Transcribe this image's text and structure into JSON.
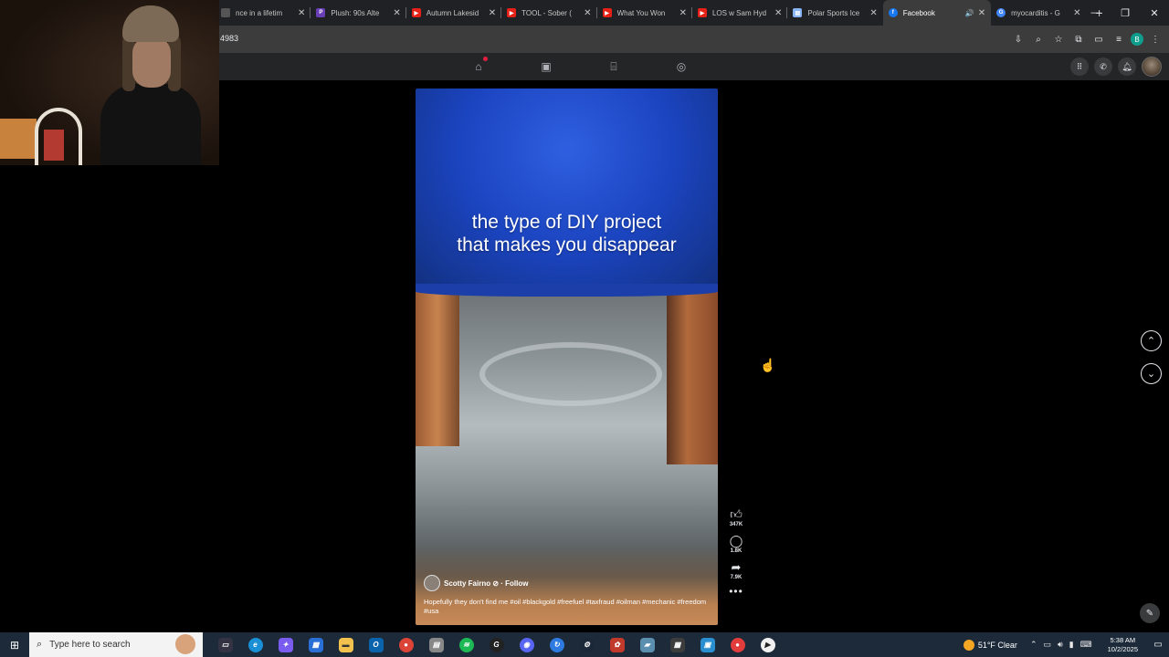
{
  "browser": {
    "tabs": [
      {
        "title": "nce in a lifetim",
        "fav_color": "#555555",
        "fav_glyph": ""
      },
      {
        "title": "Plush: 90s Alte",
        "fav_color": "#6a3fb5",
        "fav_glyph": "P"
      },
      {
        "title": "Autumn Lakesid",
        "fav_color": "#e62117",
        "fav_glyph": "▶"
      },
      {
        "title": "TOOL - Sober (",
        "fav_color": "#e62117",
        "fav_glyph": "▶"
      },
      {
        "title": "What You Won",
        "fav_color": "#e62117",
        "fav_glyph": "▶"
      },
      {
        "title": "LOS w Sam Hyd",
        "fav_color": "#e62117",
        "fav_glyph": "▶"
      },
      {
        "title": "Polar Sports Ice",
        "fav_color": "#8ab4f8",
        "fav_glyph": "▤"
      },
      {
        "title": "Facebook",
        "fav_color": "#1877f2",
        "fav_glyph": "f"
      },
      {
        "title": "myocarditis - G",
        "fav_color": "#4285f4",
        "fav_glyph": "G"
      }
    ],
    "active_tab_index": 7,
    "new_tab": "+",
    "address_text": "4983",
    "profile_initial": "B",
    "window_controls": {
      "minimize": "—",
      "restore": "❐",
      "close": "✕"
    }
  },
  "fb": {
    "nav_icons": [
      "home-icon",
      "video-icon",
      "marketplace-icon",
      "groups-icon"
    ],
    "right_icons": [
      "menu-grid-icon",
      "messenger-icon",
      "bell-icon"
    ]
  },
  "reel": {
    "caption_line1": "the type of DIY project",
    "caption_line2": "that makes you disappear",
    "author": "Scotty Fairno ⊘ · Follow",
    "description": "Hopefully they don't find me #oil #blackgold #freefuel #taxfraud #oilman #mechanic #freedom #usa",
    "likes": "347K",
    "comments": "1.8K",
    "shares": "7.9K",
    "more": "•••"
  },
  "nav_buttons": {
    "prev": "⌃",
    "next": "⌄"
  },
  "taskbar": {
    "search_placeholder": "Type here to search",
    "weather": "51°F  Clear",
    "time": "5:38 AM",
    "date": "10/2/2025"
  },
  "colors": {
    "tab_bg": "#202124",
    "active_tab_bg": "#3c3c3c",
    "fb_nav_bg": "#242526",
    "taskbar_bg": "#1c2a3a",
    "video_blue": "#1b44c0"
  }
}
